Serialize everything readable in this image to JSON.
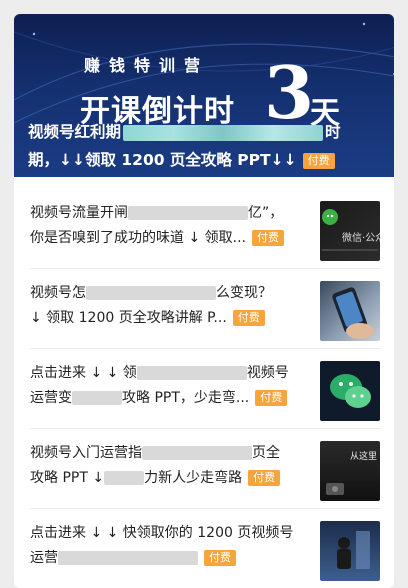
{
  "hero": {
    "subtitle": "赚钱特训营",
    "headline": "开课倒计时",
    "count": "3",
    "unit": "天",
    "title_part1": "视频号红利期",
    "title_part2": "时",
    "title_line2": "期，↓↓领取 1200 页全攻略 PPT↓↓",
    "tag": "付费"
  },
  "articles": [
    {
      "line1a": "视频号流量开闸",
      "line1b": "亿”，",
      "line2": "你是否嗅到了成功的味道 ↓ 领取...",
      "tag": "付费",
      "thumb_icon": "wechat-channels-icon",
      "thumb_text": "微信·公众"
    },
    {
      "line1a": "视频号怎",
      "line1b": "么变现？",
      "line2": "↓ 领取 1200 页全攻略讲解 P...",
      "tag": "付费",
      "thumb_icon": "smartphone-icon",
      "thumb_text": ""
    },
    {
      "line1a": "点击进来 ↓ ↓ 领",
      "line1b": "视频号",
      "line2a": "运营变",
      "line2b": "攻略 PPT，少走弯...",
      "tag": "付费",
      "thumb_icon": "wechat-logo-icon",
      "thumb_text": ""
    },
    {
      "line1a": "视频号入门运营指",
      "line1b": "页全",
      "line2a": "攻略 PPT ↓",
      "line2b": "力新人少走弯路",
      "tag": "付费",
      "thumb_icon": "camera-icon",
      "thumb_text": "从这里 影响世界"
    },
    {
      "line1a": "点击进来 ↓ ↓ 快领取你的 1200 页视频号",
      "line1b": "",
      "line2a": "运营",
      "line2b": "",
      "tag": "付费",
      "thumb_icon": "person-icon",
      "thumb_text": ""
    }
  ]
}
